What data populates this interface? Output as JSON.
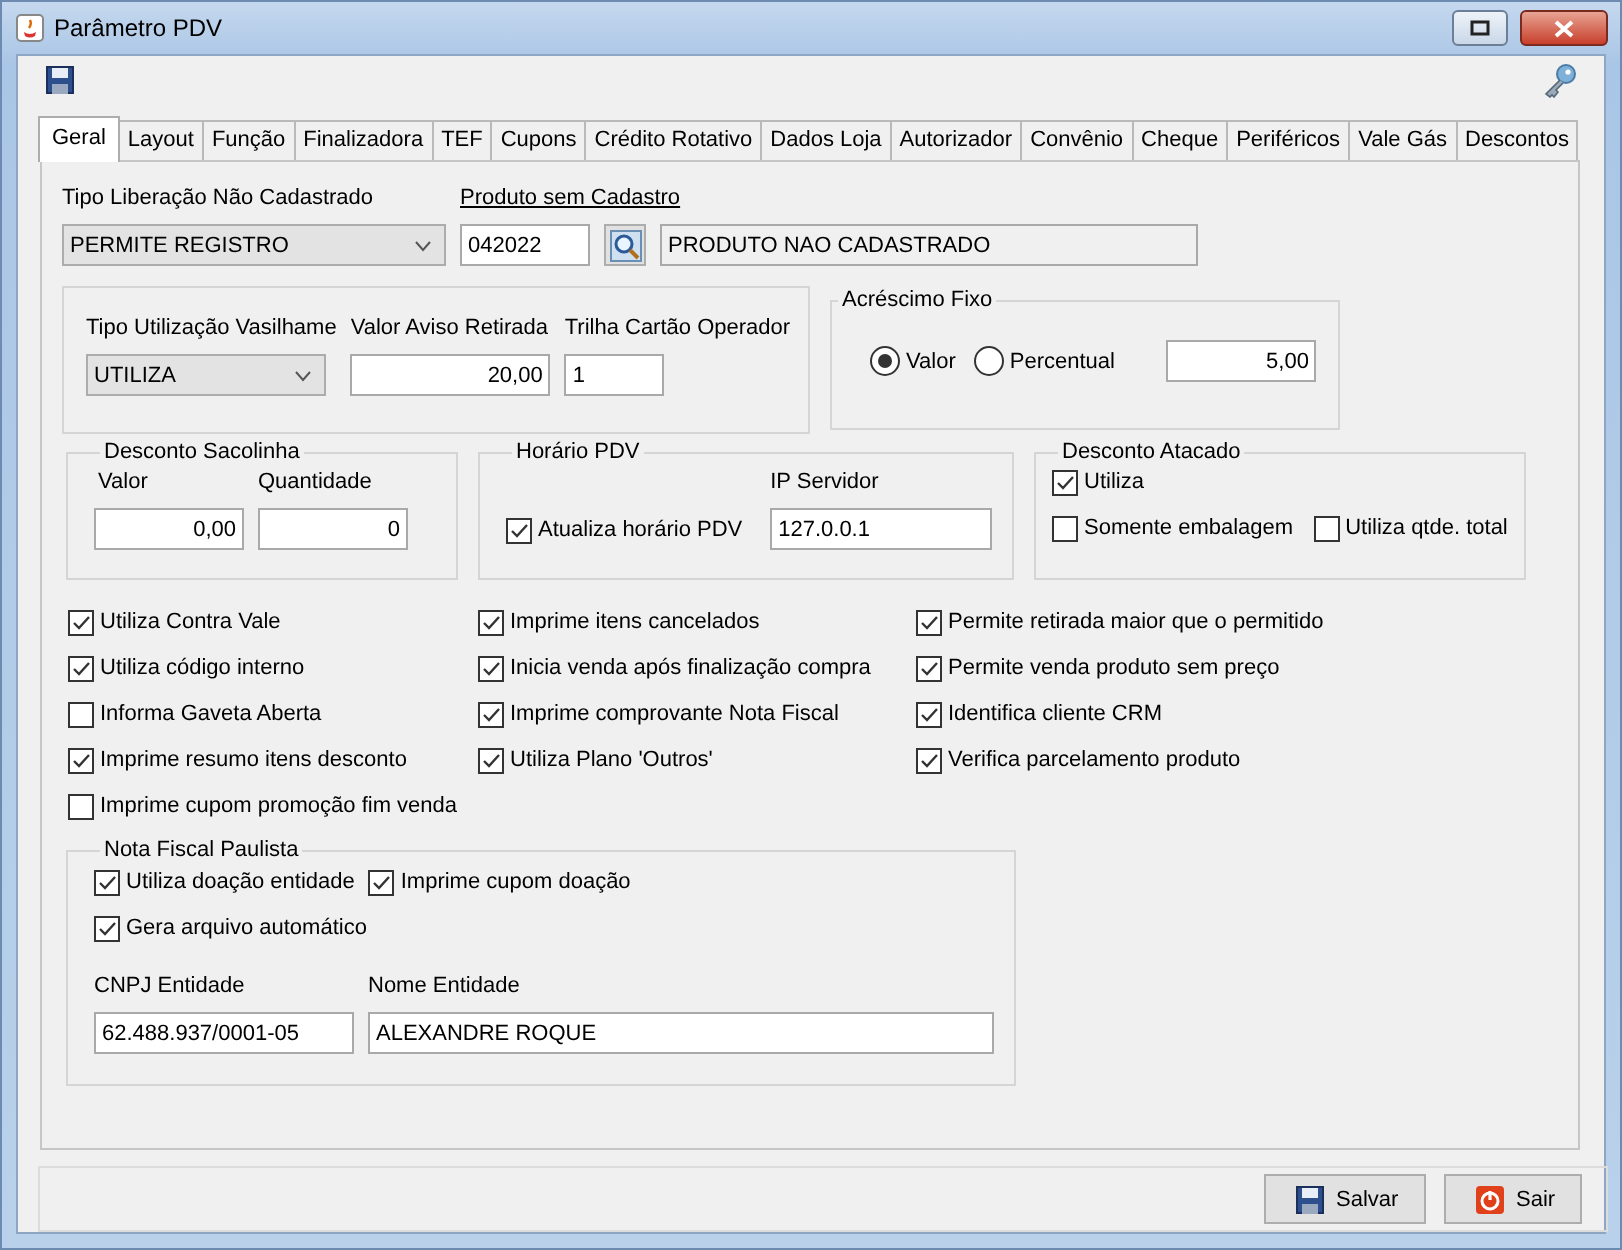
{
  "window": {
    "title": "Parâmetro PDV"
  },
  "tabs": [
    {
      "label": "Geral",
      "selected": true
    },
    {
      "label": "Layout",
      "selected": false
    },
    {
      "label": "Função",
      "selected": false
    },
    {
      "label": "Finalizadora",
      "selected": false
    },
    {
      "label": "TEF",
      "selected": false
    },
    {
      "label": "Cupons",
      "selected": false
    },
    {
      "label": "Crédito Rotativo",
      "selected": false
    },
    {
      "label": "Dados Loja",
      "selected": false
    },
    {
      "label": "Autorizador",
      "selected": false
    },
    {
      "label": "Convênio",
      "selected": false
    },
    {
      "label": "Cheque",
      "selected": false
    },
    {
      "label": "Periféricos",
      "selected": false
    },
    {
      "label": "Vale Gás",
      "selected": false
    },
    {
      "label": "Descontos",
      "selected": false
    }
  ],
  "tipo_liberacao": {
    "label": "Tipo Liberação Não Cadastrado",
    "value": "PERMITE REGISTRO"
  },
  "produto_sem_cadastro": {
    "label": "Produto sem Cadastro",
    "code": "042022",
    "description": "PRODUTO NAO CADASTRADO"
  },
  "vasilhame": {
    "tipo_utilizacao": {
      "label": "Tipo Utilização Vasilhame",
      "value": "UTILIZA"
    },
    "valor_aviso_retirada": {
      "label": "Valor Aviso Retirada",
      "value": "20,00"
    },
    "trilha_cartao_operador": {
      "label": "Trilha Cartão Operador",
      "value": "1"
    }
  },
  "acrescimo_fixo": {
    "title": "Acréscimo Fixo",
    "options": [
      {
        "label": "Valor",
        "selected": true
      },
      {
        "label": "Percentual",
        "selected": false
      }
    ],
    "value": "5,00"
  },
  "desconto_sacolinha": {
    "title": "Desconto Sacolinha",
    "valor": {
      "label": "Valor",
      "value": "0,00"
    },
    "quantidade": {
      "label": "Quantidade",
      "value": "0"
    }
  },
  "horario_pdv": {
    "title": "Horário PDV",
    "atualiza": {
      "label": "Atualiza horário PDV",
      "checked": true
    },
    "ip_servidor": {
      "label": "IP Servidor",
      "value": "127.0.0.1"
    }
  },
  "desconto_atacado": {
    "title": "Desconto Atacado",
    "options": [
      {
        "label": "Utiliza",
        "checked": true
      },
      {
        "label": "Somente embalagem",
        "checked": false
      },
      {
        "label": "Utiliza qtde. total",
        "checked": false
      }
    ]
  },
  "option_columns": [
    [
      {
        "label": "Utiliza Contra Vale",
        "checked": true
      },
      {
        "label": "Utiliza código interno",
        "checked": true
      },
      {
        "label": "Informa Gaveta Aberta",
        "checked": false
      },
      {
        "label": "Imprime resumo itens desconto",
        "checked": true
      },
      {
        "label": "Imprime cupom promoção fim venda",
        "checked": false
      }
    ],
    [
      {
        "label": "Imprime itens cancelados",
        "checked": true
      },
      {
        "label": "Inicia venda após finalização compra",
        "checked": true
      },
      {
        "label": "Imprime comprovante Nota Fiscal",
        "checked": true
      },
      {
        "label": "Utiliza Plano 'Outros'",
        "checked": true
      }
    ],
    [
      {
        "label": "Permite retirada maior que o permitido",
        "checked": true
      },
      {
        "label": "Permite venda produto sem preço",
        "checked": true
      },
      {
        "label": "Identifica cliente CRM",
        "checked": true
      },
      {
        "label": "Verifica parcelamento produto",
        "checked": true
      }
    ]
  ],
  "nota_fiscal_paulista": {
    "title": "Nota Fiscal Paulista",
    "options": [
      {
        "label": "Utiliza doação entidade",
        "checked": true
      },
      {
        "label": "Imprime cupom doação",
        "checked": true
      },
      {
        "label": "Gera arquivo automático",
        "checked": true
      }
    ],
    "cnpj": {
      "label": "CNPJ Entidade",
      "value": "62.488.937/0001-05"
    },
    "nome": {
      "label": "Nome Entidade",
      "value": "ALEXANDRE ROQUE"
    }
  },
  "buttons": [
    {
      "label": "Salvar",
      "kind": "save"
    },
    {
      "label": "Sair",
      "kind": "exit"
    }
  ]
}
